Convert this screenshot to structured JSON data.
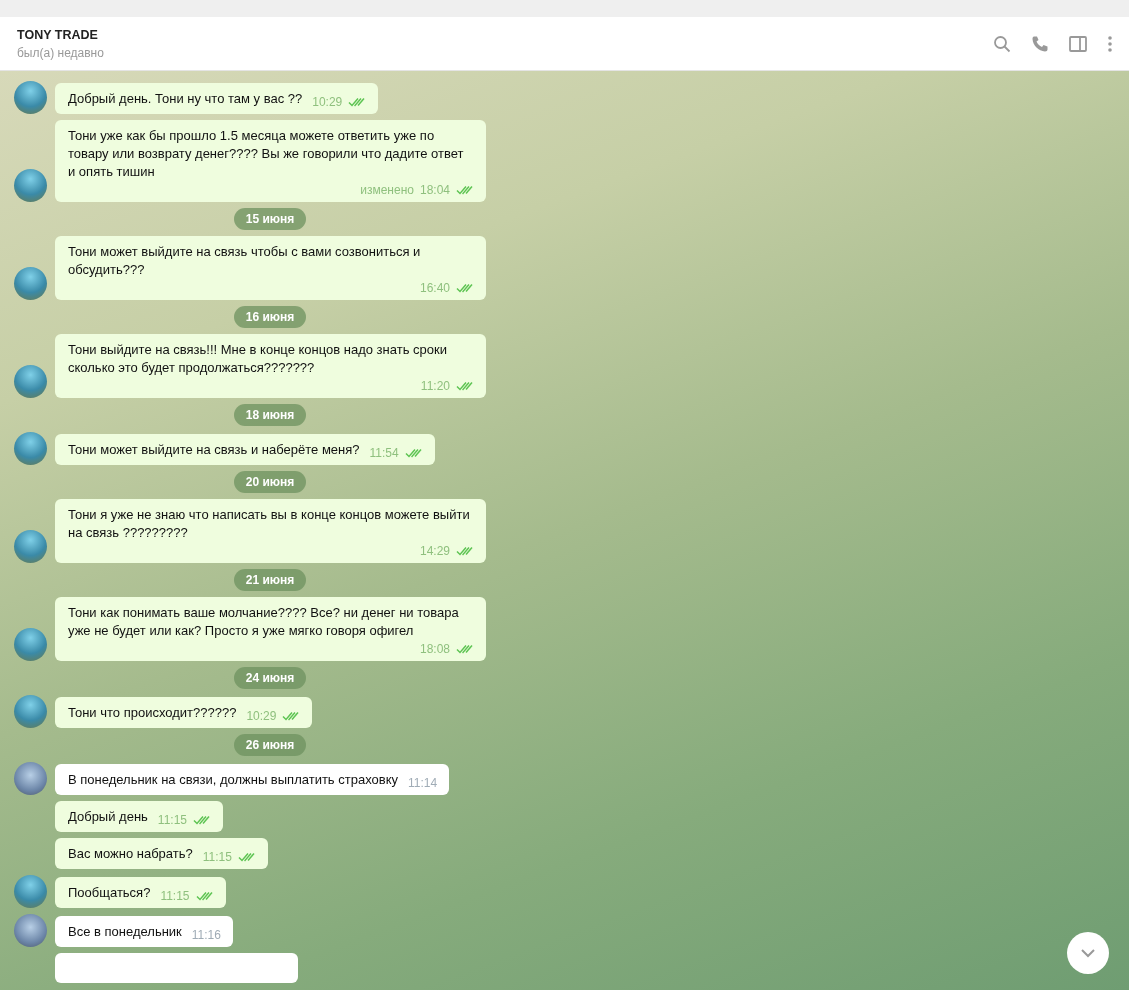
{
  "header": {
    "title": "TONY TRADE",
    "status": "был(а) недавно"
  },
  "messages": [
    {
      "kind": "outgoing",
      "text": "Добрый день. Тони ну что там у вас ??",
      "time": "10:29",
      "read": true,
      "avatar": true
    },
    {
      "kind": "outgoing",
      "text": "Тони уже как бы прошло 1.5 месяца можете ответить уже по товару или возврату денег???? Вы же говорили что дадите ответ и опять тишин",
      "edited": "изменено",
      "time": "18:04",
      "read": true,
      "avatar": true
    },
    {
      "kind": "date",
      "text": "15 июня"
    },
    {
      "kind": "outgoing",
      "text": "Тони может выйдите на связь чтобы с вами созвониться и обсудить???",
      "time": "16:40",
      "read": true,
      "avatar": true
    },
    {
      "kind": "date",
      "text": "16 июня"
    },
    {
      "kind": "outgoing",
      "text": "Тони выйдите на связь!!! Мне в конце концов надо знать сроки сколько это будет продолжаться???????",
      "time": "11:20",
      "read": true,
      "avatar": true
    },
    {
      "kind": "date",
      "text": "18 июня"
    },
    {
      "kind": "outgoing",
      "text": "Тони может выйдите на связь и наберёте меня?",
      "time": "11:54",
      "read": true,
      "avatar": true
    },
    {
      "kind": "date",
      "text": "20 июня"
    },
    {
      "kind": "outgoing",
      "text": "Тони я уже не знаю что написать вы в конце концов можете выйти на связь ?????????",
      "time": "14:29",
      "read": true,
      "avatar": true
    },
    {
      "kind": "date",
      "text": "21 июня"
    },
    {
      "kind": "outgoing",
      "text": "Тони как понимать ваше молчание???? Все?  ни денег ни товара уже не будет или как? Просто я уже мягко говоря офигел",
      "time": "18:08",
      "read": true,
      "avatar": true
    },
    {
      "kind": "date",
      "text": "24 июня"
    },
    {
      "kind": "outgoing",
      "text": "Тони что происходит??????",
      "time": "10:29",
      "read": true,
      "avatar": true
    },
    {
      "kind": "date",
      "text": "26 июня"
    },
    {
      "kind": "incoming",
      "text": "В понедельник на связи, должны выплатить страховку",
      "time": "11:14",
      "avatar": true
    },
    {
      "kind": "outgoing",
      "text": "Добрый день",
      "time": "11:15",
      "read": true,
      "avatar": false
    },
    {
      "kind": "outgoing",
      "text": "Вас можно набрать?",
      "time": "11:15",
      "read": true,
      "avatar": false
    },
    {
      "kind": "outgoing",
      "text": "Пообщаться?",
      "time": "11:15",
      "read": true,
      "avatar": true
    },
    {
      "kind": "incoming",
      "text": "Все в понедельник",
      "time": "11:16",
      "avatar": true
    },
    {
      "kind": "partial"
    }
  ]
}
